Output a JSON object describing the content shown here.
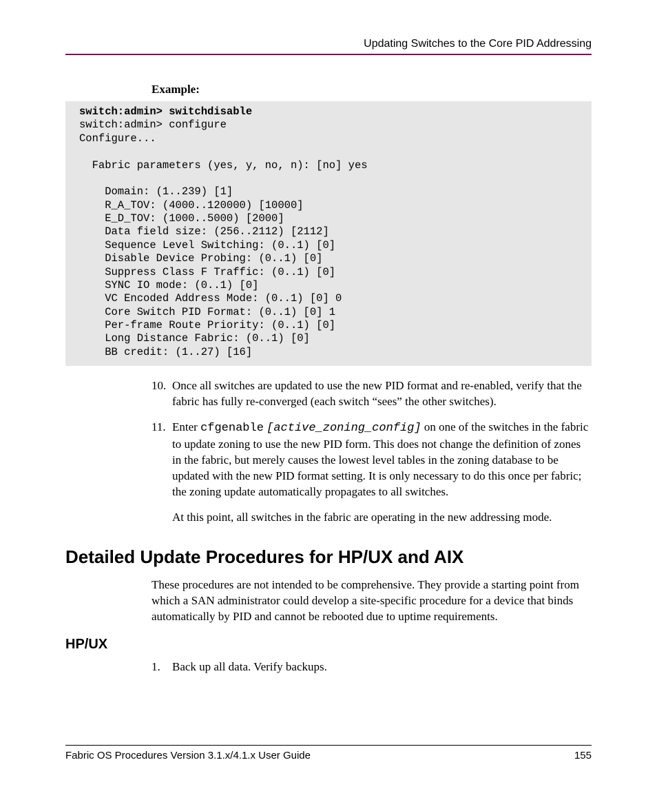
{
  "header": {
    "right_text": "Updating Switches to the Core PID Addressing"
  },
  "example_label": "Example:",
  "code": {
    "bold_line": "switch:admin> switchdisable",
    "rest": "switch:admin> configure\nConfigure...\n\n  Fabric parameters (yes, y, no, n): [no] yes\n\n    Domain: (1..239) [1]\n    R_A_TOV: (4000..120000) [10000]\n    E_D_TOV: (1000..5000) [2000]\n    Data field size: (256..2112) [2112]\n    Sequence Level Switching: (0..1) [0]\n    Disable Device Probing: (0..1) [0]\n    Suppress Class F Traffic: (0..1) [0]\n    SYNC IO mode: (0..1) [0]\n    VC Encoded Address Mode: (0..1) [0] 0\n    Core Switch PID Format: (0..1) [0] 1\n    Per-frame Route Priority: (0..1) [0]\n    Long Distance Fabric: (0..1) [0]\n    BB credit: (1..27) [16]"
  },
  "steps": {
    "s10": {
      "num": "10.",
      "text": "Once all switches are updated to use the new PID format and re-enabled, verify that the fabric has fully re-converged (each switch “sees” the other switches)."
    },
    "s11": {
      "num": "11.",
      "lead": "Enter ",
      "cmd1": "cfgenable",
      "space": " ",
      "cmd2": "[active_zoning_config]",
      "tail": " on one of the switches in the fabric to update zoning to use the new PID form. This does not change the definition of zones in the fabric, but merely causes the lowest level tables in the zoning database to be updated with the new PID format setting. It is only necessary to do this once per fabric; the zoning update automatically propagates to all switches.",
      "follow": "At this point, all switches in the fabric are operating in the new addressing mode."
    }
  },
  "section_heading": "Detailed Update Procedures for HP/UX and AIX",
  "section_intro": "These procedures are not intended to be comprehensive. They provide a starting point from which a SAN administrator could develop a site-specific procedure for a device that binds automatically by PID and cannot be rebooted due to uptime requirements.",
  "subheading": "HP/UX",
  "sub_steps": {
    "s1": {
      "num": "1.",
      "text": "Back up all data. Verify backups."
    }
  },
  "footer": {
    "left": "Fabric OS Procedures Version 3.1.x/4.1.x User Guide",
    "right": "155"
  }
}
